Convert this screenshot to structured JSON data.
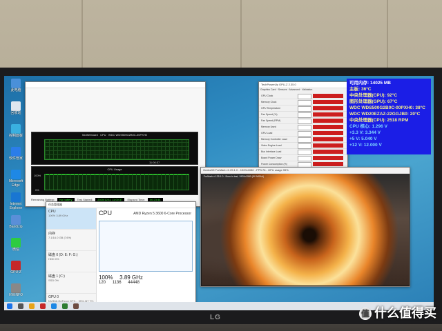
{
  "osd": {
    "lines": [
      {
        "text": "可用内存: 14025 MB",
        "color": "#ffffff"
      },
      {
        "text": "主板: 36°C",
        "color": "#f7f08a"
      },
      {
        "text": "中央处理器(CPU): 92°C",
        "color": "#f7f08a"
      },
      {
        "text": "图形处理器(GPU): 67°C",
        "color": "#f7f08a"
      },
      {
        "text": "WDC WDS500G2B0C-00PXH0: 38°C",
        "color": "#f7f08a"
      },
      {
        "text": "WDC WD20EZAZ-22GGJB0: 20°C",
        "color": "#f7f08a"
      },
      {
        "text": "中央处理器(CPU): 2518 RPM",
        "color": "#f7f08a"
      },
      {
        "text": "CPU 核心: 1.296 V",
        "color": "#7fd8ff"
      },
      {
        "text": "+3.3 V: 3.344 V",
        "color": "#7fd8ff"
      },
      {
        "text": "+5 V: 5.040 V",
        "color": "#7fd8ff"
      },
      {
        "text": "+12 V: 12.000 V",
        "color": "#7fd8ff"
      }
    ]
  },
  "task_manager": {
    "title": "任务管理器",
    "sidebar": [
      {
        "name": "CPU",
        "sub": "100% 3.89 GHz"
      },
      {
        "name": "内存",
        "sub": "7.1/16.0 GB (74%)"
      },
      {
        "name": "磁盘 0 (D: E: F: G:)",
        "sub": "HDD 0%"
      },
      {
        "name": "磁盘 1 (C:)",
        "sub": "SSD 0%"
      },
      {
        "name": "GPU 0",
        "sub": "NVIDIA GeForce GTX... 99% (67 °C)"
      }
    ],
    "heading": "CPU",
    "processor": "AMD Ryzen 5 3600 6-Core Processor",
    "utilization": "100%",
    "speed": "3.89 GHz",
    "processes": "120",
    "threads": "1136",
    "handles": "44448"
  },
  "hwinfo": {
    "graph1_legend": [
      "Motherboard",
      "CPU",
      "WDC WDS500G2B0C-00PXH0"
    ],
    "graph2_title": "CPU Usage",
    "y_top": "100%",
    "y_bottom": "0%",
    "time": "11:00:37",
    "status": {
      "remaining_label": "Remaining Battery:",
      "remaining_value": "No battery",
      "test_started_label": "Test Started:",
      "test_started_value": "2020/12/11 11:00:37",
      "elapsed_label": "Elapsed Time:",
      "elapsed_value": "00:23:44"
    }
  },
  "gpuz": {
    "title": "TechPowerUp GPU-Z 2.35.0",
    "tabs": [
      "Graphics Card",
      "Sensors",
      "Advanced",
      "Validation"
    ],
    "sensors": [
      {
        "name": "GPU Clock",
        "status": "red"
      },
      {
        "name": "Memory Clock",
        "status": "red"
      },
      {
        "name": "GPU Temperature",
        "status": "red"
      },
      {
        "name": "Fan Speed (%)",
        "status": "red"
      },
      {
        "name": "Fan Speed (RPM)",
        "status": "red"
      },
      {
        "name": "Memory Used",
        "status": "red"
      },
      {
        "name": "GPU Load",
        "status": "red"
      },
      {
        "name": "Memory Controller Load",
        "status": "red"
      },
      {
        "name": "Video Engine Load",
        "status": "red"
      },
      {
        "name": "Bus Interface Load",
        "status": "red"
      },
      {
        "name": "Board Power Draw",
        "status": "red"
      },
      {
        "name": "Power Consumption (%)",
        "status": "red"
      },
      {
        "name": "PerfCap Reason",
        "status": "green"
      },
      {
        "name": "Power Consumption (W)",
        "status": "red"
      }
    ]
  },
  "furmark": {
    "title": "Geeks3D FurMark v1.25.1.0 - 1920x1080 - FPS:76 - GPU usage 99%",
    "info": "FurMark v1.25.1.0 - Burn-in test, 1920x1080 (8X MSAA)"
  },
  "desktop": {
    "icons": [
      {
        "label": "此电脑",
        "color": "#4a90d9"
      },
      {
        "label": "回收站",
        "color": "#dfe7ef"
      },
      {
        "label": "控制面板",
        "color": "#3ab0e0"
      },
      {
        "label": "软件管家",
        "color": "#2b7de9"
      },
      {
        "label": "Microsoft Edge",
        "color": "#1e88e5"
      },
      {
        "label": "Internet Explorer",
        "color": "#1976d2"
      },
      {
        "label": "Bandizip",
        "color": "#5a8fd8"
      },
      {
        "label": "微信",
        "color": "#2ecc40"
      },
      {
        "label": "GPU-Z",
        "color": "#c62828"
      },
      {
        "label": "HWiNFO",
        "color": "#888888"
      }
    ]
  },
  "monitor": {
    "brand": "LG"
  },
  "watermark": {
    "circle": "值",
    "text": "什么值得买"
  }
}
